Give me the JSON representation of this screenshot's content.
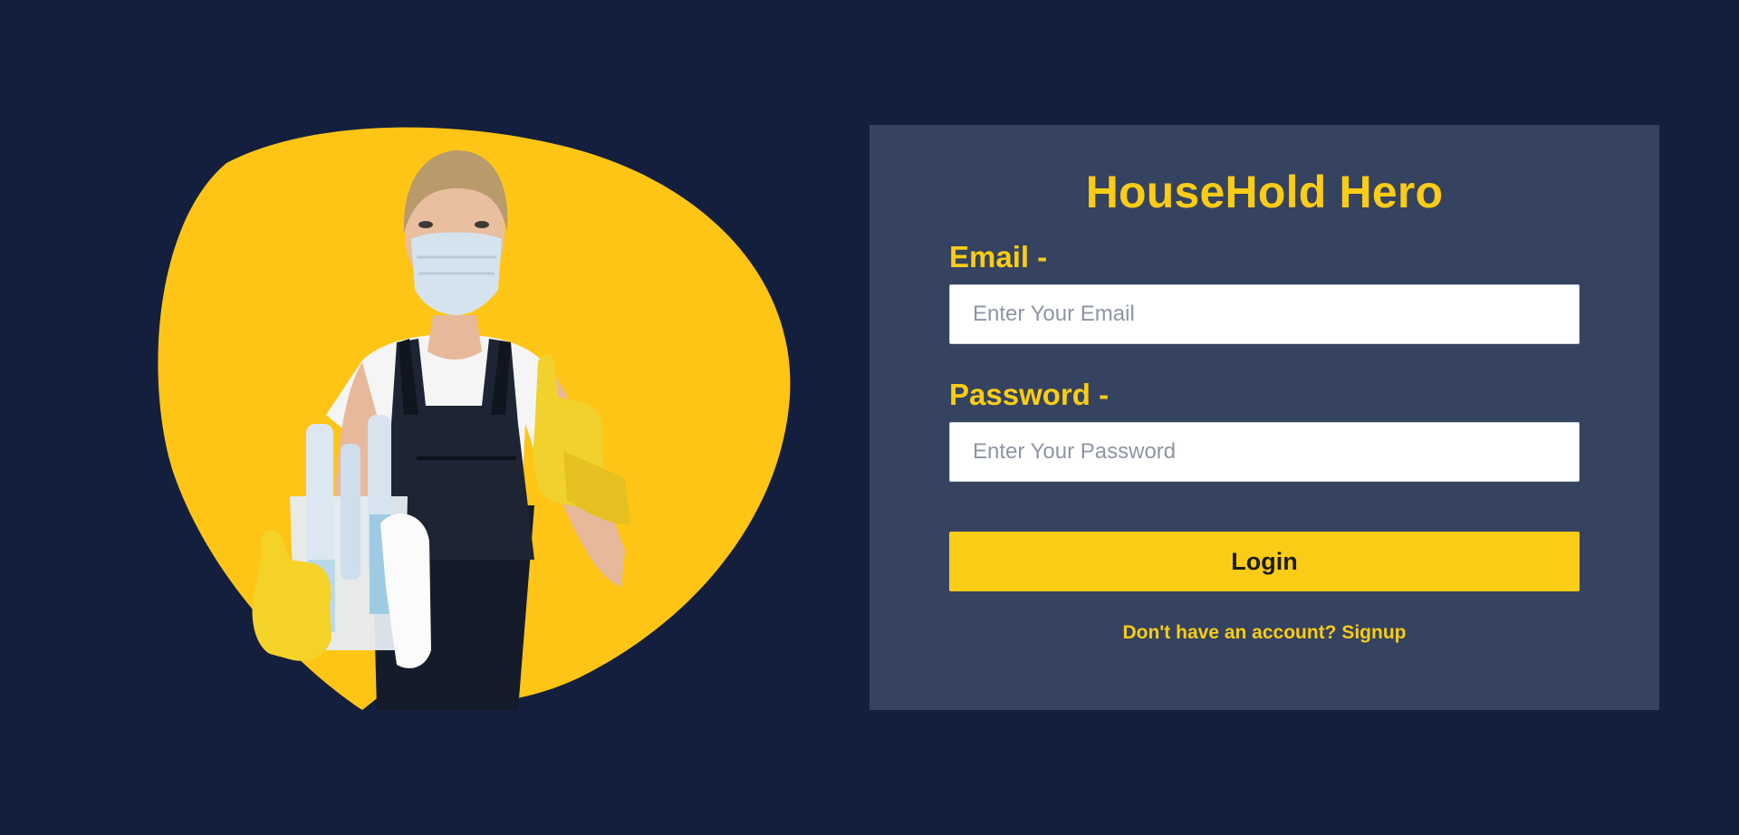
{
  "colors": {
    "background": "#131f3c",
    "card": "#354360",
    "accent": "#facc15",
    "blob": "#ffc516"
  },
  "hero": {
    "image_subject": "cleaner-thumbs-up",
    "icon": "cleaning-worker-illustration"
  },
  "login_form": {
    "title": "HouseHold Hero",
    "email_label": "Email -",
    "email_placeholder": "Enter Your Email",
    "email_value": "",
    "password_label": "Password -",
    "password_placeholder": "Enter Your Password",
    "password_value": "",
    "login_button": "Login",
    "signup_text": "Don't have an account? Signup"
  }
}
